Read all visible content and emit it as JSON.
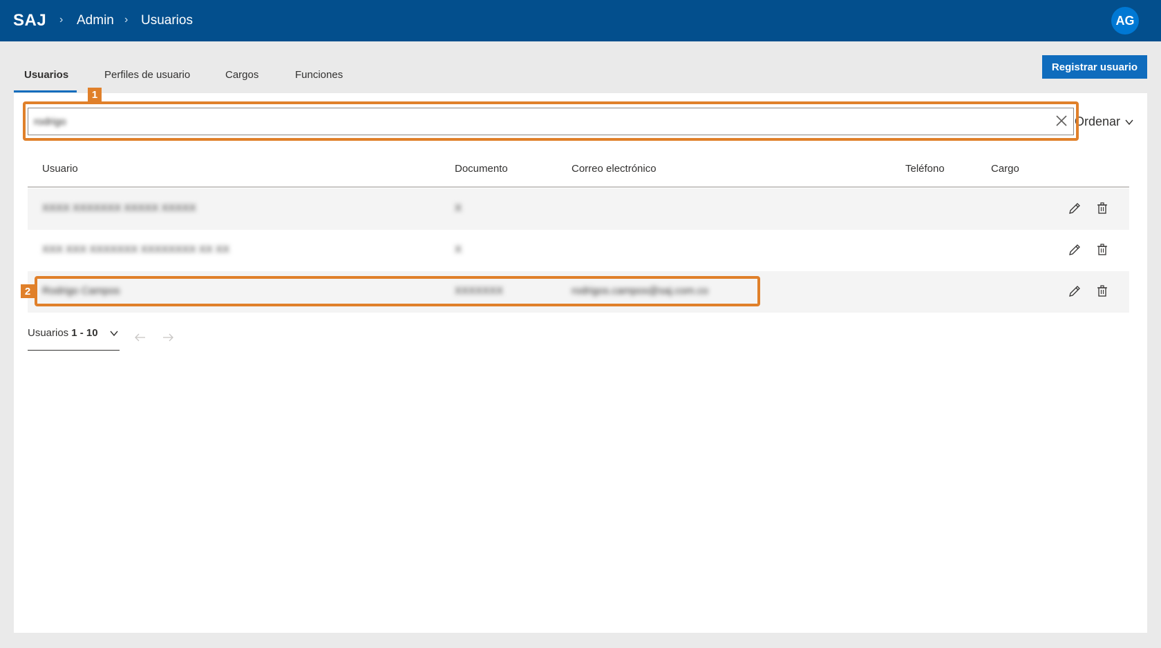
{
  "header": {
    "logo": "SAJ",
    "breadcrumb": [
      "Admin",
      "Usuarios"
    ],
    "avatar_initials": "AG"
  },
  "tabs": [
    {
      "label": "Usuarios",
      "active": true
    },
    {
      "label": "Perfiles de usuario",
      "active": false
    },
    {
      "label": "Cargos",
      "active": false
    },
    {
      "label": "Funciones",
      "active": false
    }
  ],
  "register_button": "Registrar usuario",
  "search": {
    "value": "rodrigo",
    "clear_icon": "close-icon"
  },
  "sort": {
    "label": "Ordenar",
    "icon": "chevron-down-icon"
  },
  "table": {
    "columns": [
      "Usuario",
      "Documento",
      "Correo electrónico",
      "Teléfono",
      "Cargo"
    ],
    "rows": [
      {
        "usuario": "XXXX XXXXXXX XXXXX XXXXX",
        "documento": "X",
        "correo": "",
        "telefono": "",
        "cargo": ""
      },
      {
        "usuario": "XXX XXX XXXXXXX XXXXXXXX XX XX",
        "documento": "X",
        "correo": "",
        "telefono": "",
        "cargo": ""
      },
      {
        "usuario": "Rodrigo Campos",
        "documento": "XXXXXXX",
        "correo": "rodrigos.campos@saj.com.co",
        "telefono": "",
        "cargo": ""
      }
    ],
    "row_actions": {
      "edit_icon": "pencil-icon",
      "delete_icon": "trash-icon"
    }
  },
  "annotations": [
    "1",
    "2"
  ],
  "pagination": {
    "label": "Usuarios",
    "range": "1 - 10"
  },
  "colors": {
    "header_bg": "#034f8d",
    "accent": "#0f6cbd",
    "annotation": "#e0802a"
  }
}
